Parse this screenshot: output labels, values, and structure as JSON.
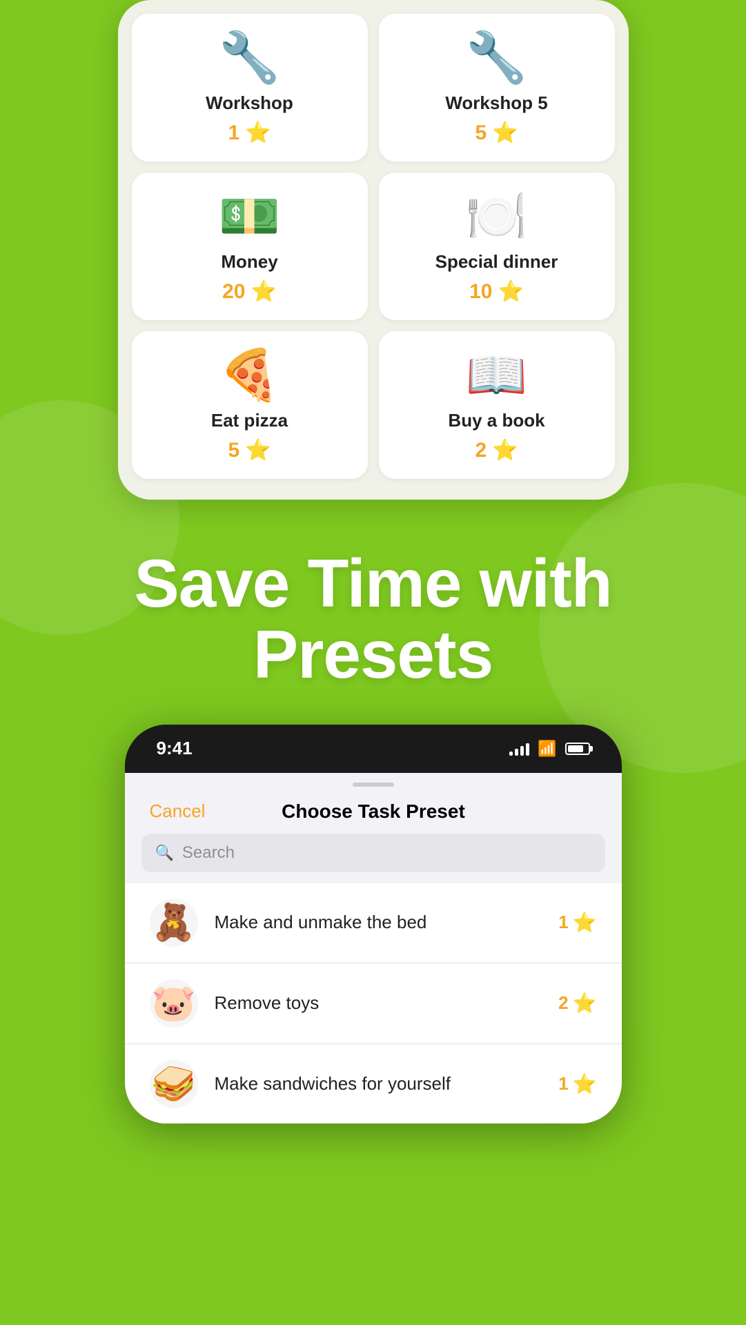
{
  "topCard": {
    "rewards": [
      {
        "id": "workshop1",
        "icon": "🔧",
        "name": "Workshop",
        "points": "1"
      },
      {
        "id": "workshop5",
        "icon": "🔧",
        "name": "Workshop 5",
        "points": "5"
      },
      {
        "id": "money20",
        "icon": "💵",
        "name": "Money",
        "points": "20"
      },
      {
        "id": "specialdinner",
        "icon": "🍽️",
        "name": "Special dinner",
        "points": "10"
      },
      {
        "id": "eatpizza",
        "icon": "🍕",
        "name": "Eat pizza",
        "points": "5"
      },
      {
        "id": "buyabook",
        "icon": "📖",
        "name": "Buy a book",
        "points": "2"
      }
    ]
  },
  "hero": {
    "line1": "Save Time with",
    "line2": "Presets"
  },
  "phone": {
    "statusBar": {
      "time": "9:41"
    },
    "sheet": {
      "cancelLabel": "Cancel",
      "titleLabel": "Choose Task Preset",
      "searchPlaceholder": "Search"
    },
    "tasks": [
      {
        "id": "make-bed",
        "emoji": "🧸",
        "name": "Make and unmake the bed",
        "points": "1"
      },
      {
        "id": "remove-toys",
        "emoji": "🐷",
        "name": "Remove toys",
        "points": "2"
      },
      {
        "id": "make-sandwiches",
        "emoji": "🥪",
        "name": "Make sandwiches for yourself",
        "points": "1"
      }
    ]
  }
}
